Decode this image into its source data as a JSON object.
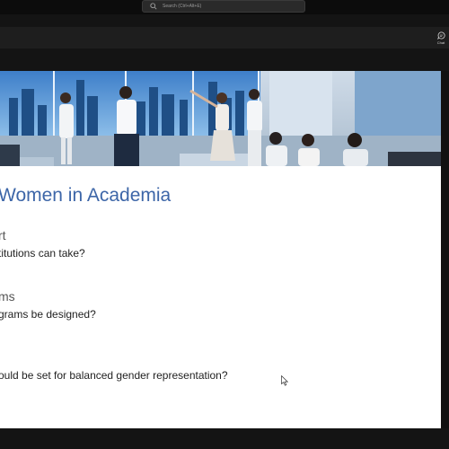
{
  "search": {
    "placeholder": "Search (Ctrl+Alt+E)"
  },
  "toolbar": {
    "chat_label": "Chat"
  },
  "slide": {
    "title": "Women in Academia",
    "sections": [
      {
        "heading": "rt",
        "question": "titutions can take?"
      },
      {
        "heading": "ms",
        "question": "grams be designed?"
      },
      {
        "heading": "",
        "question": "ould be set for balanced gender representation?"
      }
    ]
  },
  "colors": {
    "title_blue": "#3d66a8",
    "app_background": "#141414",
    "slide_background": "#ffffff"
  },
  "icons": [
    "search-icon",
    "chat-icon",
    "mouse-pointer-icon"
  ]
}
